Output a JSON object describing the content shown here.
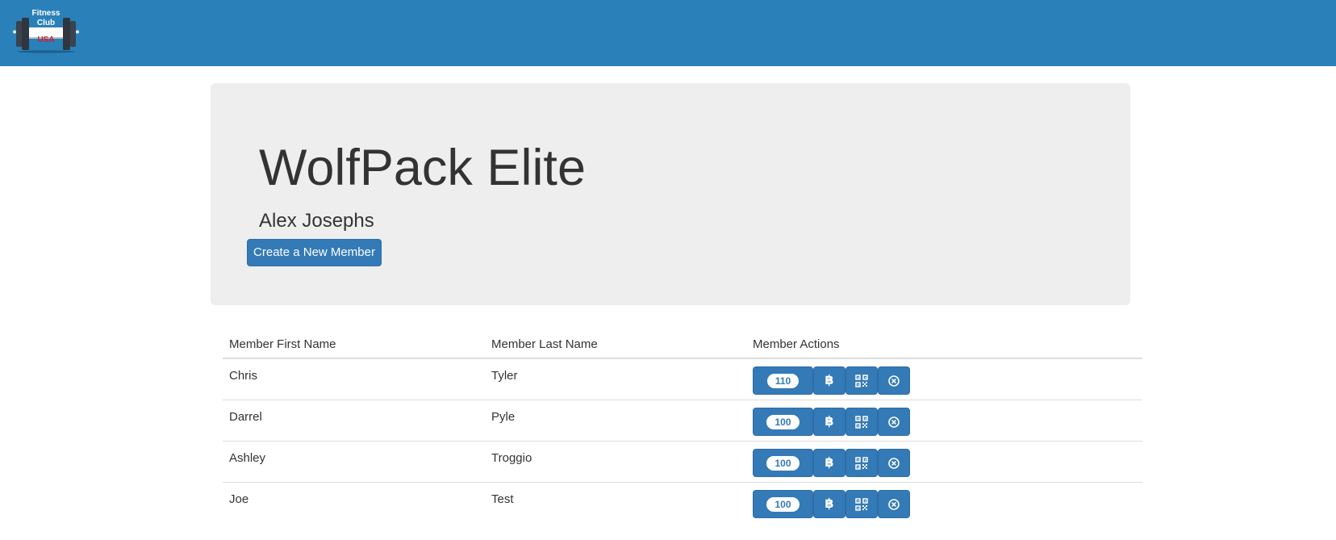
{
  "navbar": {
    "logo": {
      "line1": "Fitness",
      "line2": "Club",
      "line3": "USA"
    }
  },
  "jumbotron": {
    "title": "WolfPack Elite",
    "subtitle": "Alex Josephs",
    "create_button_label": "Create a New Member"
  },
  "table": {
    "headers": [
      "Member First Name",
      "Member Last Name",
      "Member Actions"
    ],
    "rows": [
      {
        "first": "Chris",
        "last": "Tyler",
        "points": "110"
      },
      {
        "first": "Darrel",
        "last": "Pyle",
        "points": "100"
      },
      {
        "first": "Ashley",
        "last": "Troggio",
        "points": "100"
      },
      {
        "first": "Joe",
        "last": "Test",
        "points": "100"
      }
    ]
  },
  "icons": {
    "bitcoin": "bitcoin-icon",
    "qr": "qr-code-icon",
    "delete": "circle-x-icon"
  },
  "colors": {
    "navbar": "#2a80b9",
    "primary": "#337ab7",
    "jumbotron": "#eeeeee",
    "logo_usa": "#d0202a"
  }
}
